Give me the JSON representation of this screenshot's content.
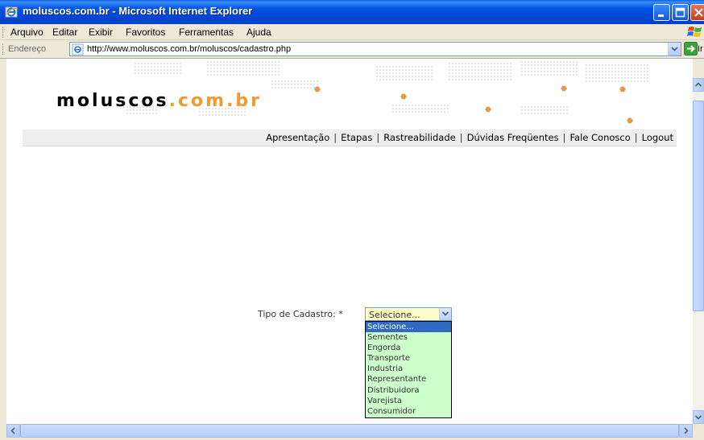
{
  "window": {
    "title": "moluscos.com.br - Microsoft Internet Explorer",
    "colors": {
      "titlebar": "#0054e3",
      "chrome": "#ece9d8"
    }
  },
  "menu": {
    "items": [
      "Arquivo",
      "Editar",
      "Exibir",
      "Favoritos",
      "Ferramentas",
      "Ajuda"
    ]
  },
  "address": {
    "label": "Endereço",
    "url": "http://www.moluscos.com.br/moluscos/cadastro.php",
    "go_label": "Ir"
  },
  "site": {
    "logo_main": "moluscos",
    "logo_domain": ".com.br",
    "nav": [
      "Apresentação",
      "Etapas",
      "Rastreabilidade",
      "Dúvidas Freqüentes",
      "Fale Conosco",
      "Logout"
    ],
    "colors": {
      "logo_accent": "#f29a30",
      "nav_bg": "#eeeeee",
      "select_bg": "#ffffcc",
      "list_bg": "#ccffcc"
    }
  },
  "form": {
    "label": "Tipo de Cadastro: *",
    "selected": "Selecione...",
    "options": [
      "Selecione...",
      "Sementes",
      "Engorda",
      "Transporte",
      "Industria",
      "Representante",
      "Distribuidora",
      "Varejista",
      "Consumidor"
    ]
  }
}
